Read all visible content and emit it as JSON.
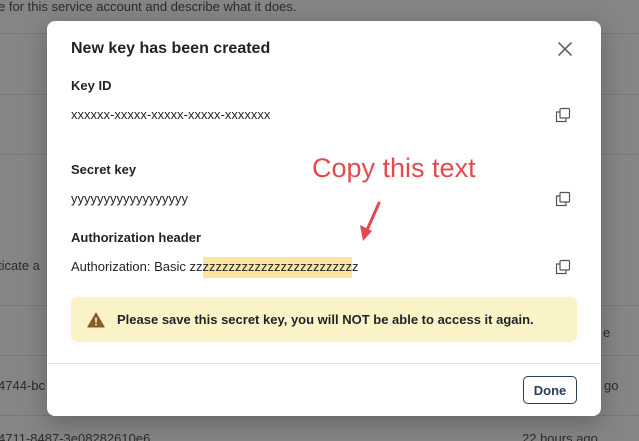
{
  "background": {
    "top_text": "e for this service account and describe what it does.",
    "left_text_1": "ticate a",
    "left_text_2": "4744-bc",
    "left_text_3": "4711-8487-3e08282610e6",
    "right_text_1": "e",
    "right_text_2": "go",
    "right_text_3": "22 hours ago"
  },
  "modal": {
    "title": "New key has been created",
    "fields": {
      "key_id": {
        "label": "Key ID",
        "value": "xxxxxx-xxxxx-xxxxx-xxxxx-xxxxxxx"
      },
      "secret_key": {
        "label": "Secret key",
        "value": "yyyyyyyyyyyyyyyyyy"
      },
      "auth_header": {
        "label": "Authorization header",
        "prefix": "Authorization: Basic zz",
        "highlighted": "zzzzzzzzzzzzzzzzzzzzzzz",
        "suffix": "z"
      }
    },
    "warning": "Please save this secret key, you will NOT be able to access it again.",
    "done_label": "Done"
  },
  "annotation": {
    "text": "Copy this text",
    "color": "#e4494e"
  },
  "icons": {
    "close": "close-icon",
    "copy": "copy-icon",
    "warning": "warning-triangle-icon"
  }
}
